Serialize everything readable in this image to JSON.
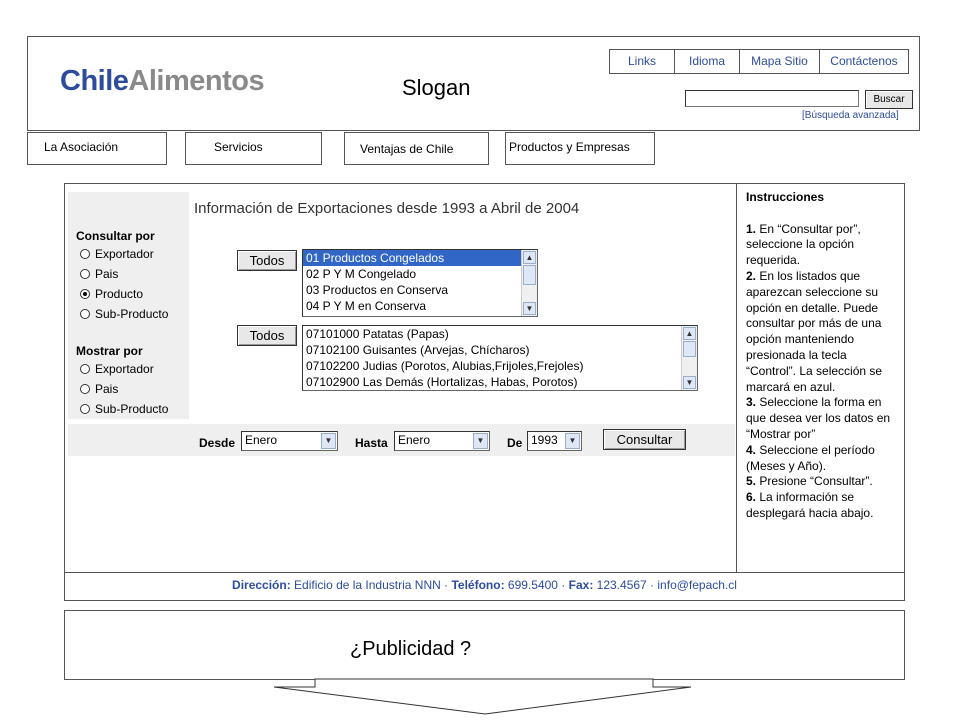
{
  "brand": {
    "part1": "Chile",
    "part2": "Alimentos",
    "slogan": "Slogan"
  },
  "top_links": [
    "Links",
    "Idioma",
    "Mapa Sitio",
    "Contáctenos"
  ],
  "search": {
    "value": "",
    "button": "Buscar",
    "advanced": "[Búsqueda avanzada]"
  },
  "nav": [
    "La Asociación",
    "Servicios",
    "Ventajas de Chile",
    "Productos y Empresas"
  ],
  "main": {
    "headline": "Información de Exportaciones desde 1993 a Abril de 2004",
    "consultar_title": "Consultar por",
    "consultar_options": [
      "Exportador",
      "Pais",
      "Producto",
      "Sub-Producto"
    ],
    "consultar_selected": "Producto",
    "mostrar_title": "Mostrar por",
    "mostrar_options": [
      "Exportador",
      "Pais",
      "Sub-Producto"
    ],
    "todos_label": "Todos",
    "list1": [
      "01 Productos Congelados",
      "02 P Y M Congelado",
      "03 Productos en Conserva",
      "04 P Y M en Conserva"
    ],
    "list1_selected": "01 Productos Congelados",
    "list2": [
      "07101000 Patatas (Papas)",
      "07102100 Guisantes (Arvejas, Chícharos)",
      "07102200 Judias (Porotos, Alubias,Frijoles,Frejoles)",
      "07102900 Las Demás (Hortalizas, Habas, Porotos)"
    ],
    "desde_label": "Desde",
    "desde_value": "Enero",
    "hasta_label": "Hasta",
    "hasta_value": "Enero",
    "de_label": "De",
    "de_value": "1993",
    "consultar_button": "Consultar"
  },
  "instructions": {
    "title": "Instrucciones",
    "steps": [
      {
        "n": "1.",
        "text": " En “Consultar por”, seleccione la opción requerida."
      },
      {
        "n": "2.",
        "text": " En los listados que aparezcan seleccione su opción en detalle. Puede consultar por más de una opción manteniendo presionada la tecla “Control”. La selección se marcará en azul."
      },
      {
        "n": "3.",
        "text": " Seleccione la forma en que desea ver los datos en “Mostrar por”"
      },
      {
        "n": "4.",
        "text": " Seleccione el período (Meses y Año)."
      },
      {
        "n": "5.",
        "text": " Presione “Consultar”."
      },
      {
        "n": "6.",
        "text": " La información se desplegará hacia abajo."
      }
    ]
  },
  "footer": {
    "dir_label": "Dirección:",
    "dir_value": " Edificio de la Industria NNN",
    "sep1": " · ",
    "tel_label": "Teléfono:",
    "tel_value": " 699.5400",
    "sep2": " · ",
    "fax_label": "Fax:",
    "fax_value": " 123.4567",
    "sep3": " · ",
    "email": "info@fepach.cl"
  },
  "ad": {
    "text": "¿Publicidad ?"
  },
  "colors": {
    "brand_blue": "#2e4c9e",
    "brand_gray": "#8a8a8a",
    "selection": "#3166c6",
    "panel_bg": "#efefef"
  }
}
